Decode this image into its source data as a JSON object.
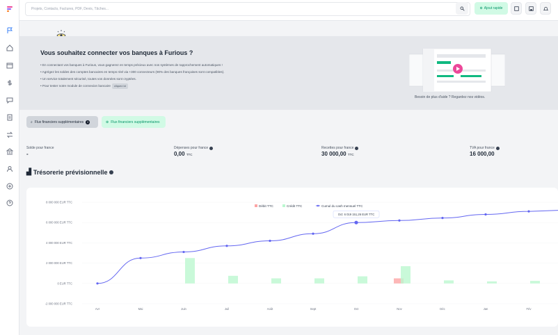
{
  "search": {
    "placeholder": "Projets, Contacts, Factures, PDF, Devis, Tâches..."
  },
  "topbar": {
    "quick_label": "Ajout rapide"
  },
  "banner": {
    "title": "Vous souhaitez connecter vos banques à Furious ?",
    "items": [
      "En connectant vos banques à Furious, vous gagnerez en temps précieux avec nos systèmes de rapprochement automatiques !",
      "Agrégez les soldes des comptes bancaires en temps réel via +300 connecteurs (90% des banques françaises sont compatibles).",
      "Un service totalement sécurisé, toutes vos données sont cryptées.",
      "Pour tester notre module de connexion bancaire"
    ],
    "cta_label": "cliquez ici",
    "help": "Besoin de plus d'aide ? Regardez nos vidéos."
  },
  "filters": {
    "dark_label": "Flux financiers supplémentaires",
    "dark_count": "2",
    "green_label": "Flux financiers supplémentaires"
  },
  "stats": [
    {
      "label": "Solde pour france",
      "value": "-",
      "unit": ""
    },
    {
      "label": "Dépenses pour france",
      "value": "0,00",
      "unit": "TTC"
    },
    {
      "label": "Recettes pour france",
      "value": "30 000,00",
      "unit": "TTC"
    },
    {
      "label": "TVA pour france",
      "value": "16 000,00",
      "unit": ""
    }
  ],
  "section_title": "Trésorerie prévisionnelle",
  "colors": {
    "debit": "#fca5a5",
    "credit": "#bbf7d0",
    "cumul": "#6366f1",
    "accent": "#10b981"
  },
  "chart_data": {
    "type": "bar",
    "categories": [
      "Avr",
      "Mai",
      "Juin",
      "Juil",
      "Août",
      "Sept",
      "Oct",
      "Nov",
      "Déc",
      "Jan",
      "Fév"
    ],
    "y_ticks": [
      "8 000 000 EUR TTC",
      "6 000 000 EUR TTC",
      "4 000 000 EUR TTC",
      "2 000 000 EUR TTC",
      "0 EUR TTC",
      "-2 000 000 EUR TTC"
    ],
    "ylim": [
      -2000000,
      8000000
    ],
    "series": [
      {
        "name": "Débit TTC",
        "kind": "bar",
        "values": [
          0,
          0,
          0,
          0,
          0,
          0,
          500000,
          0,
          0,
          0,
          0
        ]
      },
      {
        "name": "Crédit TTC",
        "kind": "bar",
        "values": [
          0,
          2500000,
          750000,
          500000,
          500000,
          700000,
          1700000,
          300000,
          200000,
          250000,
          200000
        ]
      },
      {
        "name": "Cumul du cash mensuel TTC",
        "kind": "line",
        "values": [
          0,
          2500000,
          3100000,
          3700000,
          4200000,
          4900000,
          6000000,
          6200000,
          6450000,
          6800000,
          7100000
        ]
      }
    ],
    "tooltip": "Oct: 6 019 151,26 EUR TTC",
    "legend_position": "top-center"
  }
}
